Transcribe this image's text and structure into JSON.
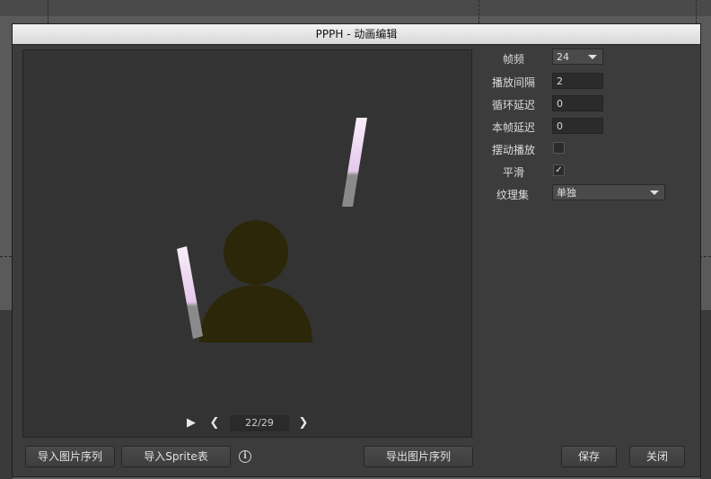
{
  "dialog": {
    "title": "PPPH - 动画编辑"
  },
  "playback": {
    "play_icon": "play-icon",
    "prev_icon": "chevron-left-icon",
    "next_icon": "chevron-right-icon",
    "frame_counter": "22/29"
  },
  "properties": {
    "fps": {
      "label": "帧频",
      "value": "24"
    },
    "play_interval": {
      "label": "播放间隔",
      "value": "2"
    },
    "loop_delay": {
      "label": "循环延迟",
      "value": "0"
    },
    "frame_delay": {
      "label": "本帧延迟",
      "value": "0"
    },
    "pingpong": {
      "label": "摆动播放",
      "checked": false
    },
    "smooth": {
      "label": "平滑",
      "checked": true,
      "check_mark": "✓"
    },
    "atlas": {
      "label": "纹理集",
      "value": "单独"
    }
  },
  "buttons": {
    "import_sequence": "导入图片序列",
    "import_sprite": "导入Sprite表",
    "export_sequence": "导出图片序列",
    "save": "保存",
    "close": "关闭"
  },
  "info_icon": "info-icon",
  "colors": {
    "preview_bg": "#333333",
    "dialog_bg": "#3c3c3c",
    "silhouette": "#2c2708",
    "stripe_top": "#f7eef8",
    "stripe_mid": "#e6c8ec",
    "stripe_bottom": "#8a8a8a"
  }
}
